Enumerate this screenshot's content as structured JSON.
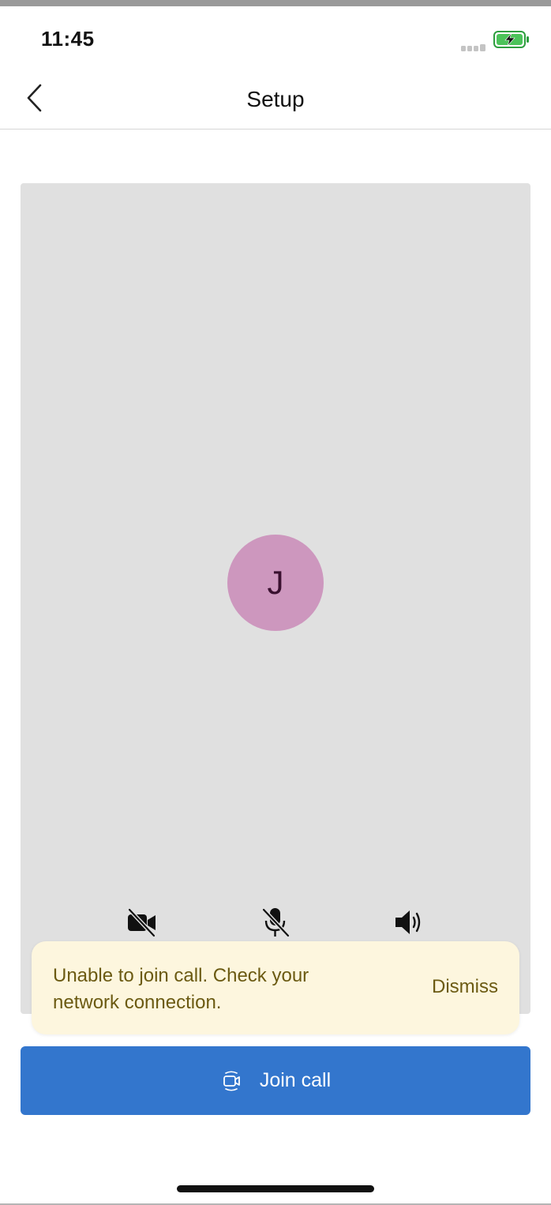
{
  "status_bar": {
    "time": "11:45"
  },
  "nav": {
    "title": "Setup",
    "back_icon": "chevron-left-icon"
  },
  "preview": {
    "avatar_initial": "J",
    "avatar_color": "#cd97be",
    "controls": [
      {
        "name": "camera-off-icon",
        "state": "off"
      },
      {
        "name": "mic-off-icon",
        "state": "off"
      },
      {
        "name": "speaker-icon",
        "state": "on"
      }
    ]
  },
  "toast": {
    "message": "Unable to join call. Check your network connection.",
    "dismiss_label": "Dismiss"
  },
  "join_button": {
    "label": "Join call",
    "icon": "video-call-icon",
    "color": "#3376cd"
  }
}
